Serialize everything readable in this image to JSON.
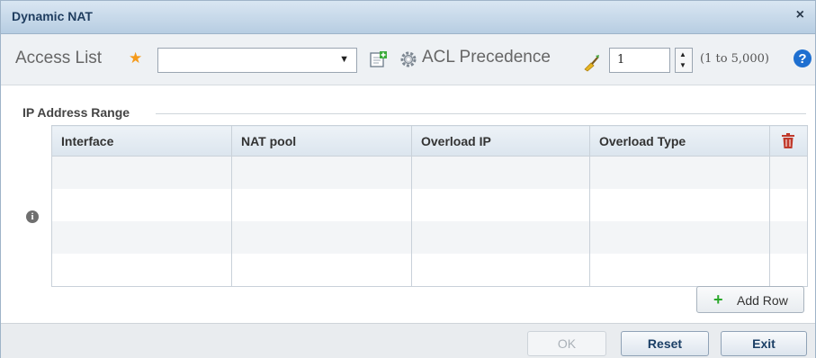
{
  "dialog": {
    "title": "Dynamic NAT",
    "close_glyph": "×"
  },
  "toolbar": {
    "access_list_label": "Access List",
    "required_star": "★",
    "access_list_value": "",
    "acl_precedence_label": "ACL Precedence",
    "acl_precedence_value": "1",
    "acl_precedence_range": "(1 to 5,000)"
  },
  "section": {
    "title": "IP Address Range"
  },
  "table": {
    "columns": [
      "Interface",
      "NAT pool",
      "Overload IP",
      "Overload Type"
    ],
    "rows": [
      [
        "",
        "",
        "",
        ""
      ],
      [
        "",
        "",
        "",
        ""
      ],
      [
        "",
        "",
        "",
        ""
      ],
      [
        "",
        "",
        "",
        ""
      ]
    ]
  },
  "actions": {
    "add_row_label": "Add Row",
    "ok_label": "OK",
    "ok_enabled": false,
    "reset_label": "Reset",
    "exit_label": "Exit"
  },
  "icons": {
    "required": "star-icon",
    "create": "create-new-icon",
    "settings": "gear-icon",
    "clear": "clear-icon",
    "help": "help-icon",
    "info": "info-icon",
    "delete": "trash-icon",
    "add": "plus-icon"
  },
  "colors": {
    "title_bar": "#c5d8ea",
    "required_star": "#f59a1a",
    "help_blue": "#1e6fd0",
    "trash_red": "#c0392b",
    "add_green": "#2aa82a",
    "button_text": "#1b3f66"
  }
}
